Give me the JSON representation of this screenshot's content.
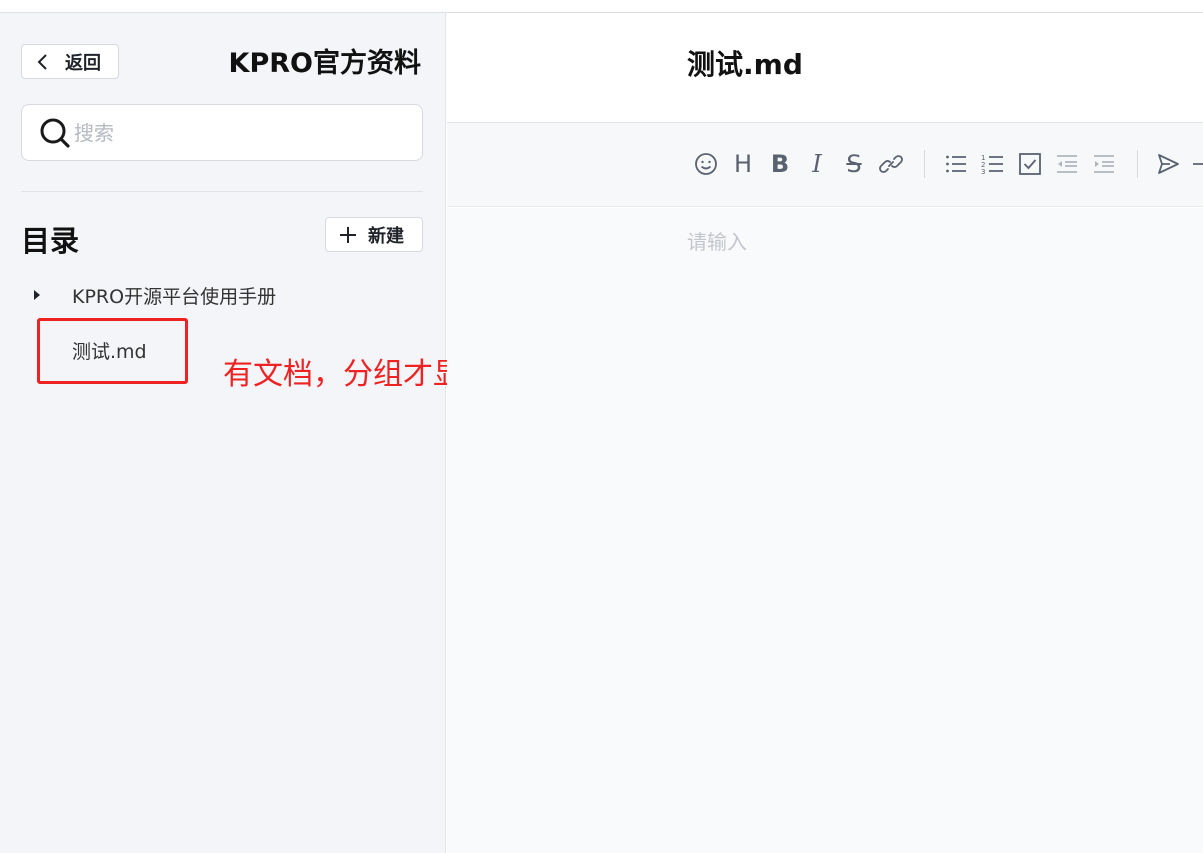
{
  "sidebar": {
    "back_label": "返回",
    "kb_title": "KPRO官方资料",
    "search_placeholder": "搜索",
    "toc_title": "目录",
    "new_label": "新建",
    "tree": [
      {
        "label": "KPRO开源平台使用手册",
        "collapsed": true
      },
      {
        "label": "测试.md"
      }
    ]
  },
  "annotation": {
    "text": "有文档，分组才显示",
    "color": "#ee2222"
  },
  "document": {
    "title": "测试.md",
    "placeholder": "请输入"
  },
  "toolbar": {
    "buttons": [
      "emoji-icon",
      "heading-icon",
      "bold-icon",
      "italic-icon",
      "strikethrough-icon",
      "link-icon",
      "bullet-list-icon",
      "ordered-list-icon",
      "checklist-icon",
      "outdent-icon",
      "indent-icon",
      "send-icon",
      "more-icon"
    ]
  },
  "colors": {
    "sidebar_bg": "#f4f5f8",
    "toolbar_bg": "#f7f8fa",
    "accent_red": "#ee2222"
  }
}
